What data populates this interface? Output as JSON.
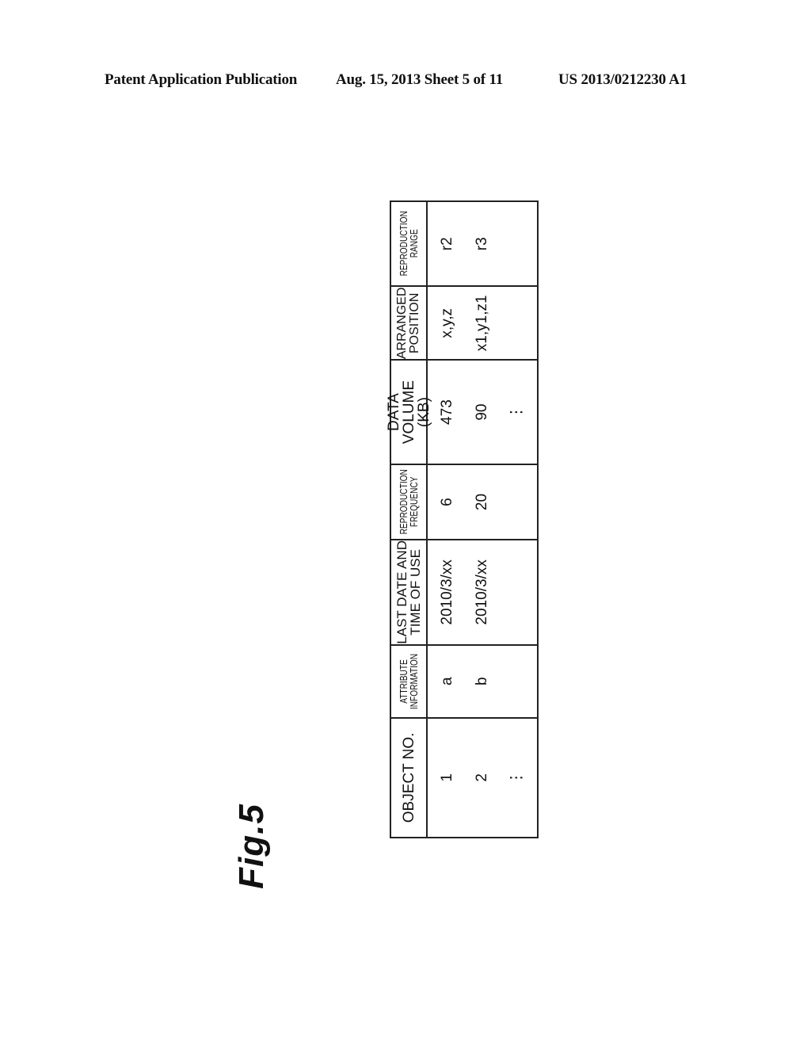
{
  "header": {
    "left": "Patent Application Publication",
    "middle": "Aug. 15, 2013  Sheet 5 of 11",
    "right": "US 2013/0212230 A1"
  },
  "figure": {
    "label": "Fig.5"
  },
  "table": {
    "columns": [
      {
        "header_lines": [
          "OBJECT NO."
        ],
        "cells": [
          "1",
          "2",
          "⋮"
        ]
      },
      {
        "header_lines": [
          "ATTRIBUTE",
          "INFORMATION"
        ],
        "cells": [
          "a",
          "b",
          ""
        ]
      },
      {
        "header_lines": [
          "LAST DATE AND",
          "TIME OF USE"
        ],
        "cells": [
          "2010/3/xx",
          "2010/3/xx",
          ""
        ]
      },
      {
        "header_lines": [
          "REPRODUCTION",
          "FREQUENCY"
        ],
        "cells": [
          "6",
          "20",
          ""
        ]
      },
      {
        "header_lines": [
          "DATA VOLUME",
          "(KB)"
        ],
        "cells": [
          "473",
          "90",
          "⋮"
        ]
      },
      {
        "header_lines": [
          "ARRANGED",
          "POSITION"
        ],
        "cells": [
          "x,y,z",
          "x1,y1,z1",
          ""
        ]
      },
      {
        "header_lines": [
          "REPRODUCTION",
          "RANGE"
        ],
        "cells": [
          "r2",
          "r3",
          ""
        ]
      }
    ]
  }
}
